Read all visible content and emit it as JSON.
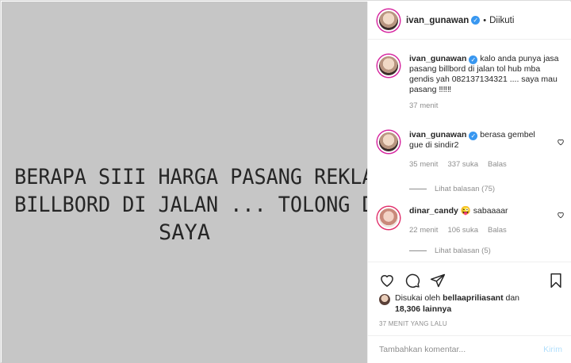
{
  "post": {
    "image_text": [
      "BERAPA SIII HARGA PASANG REKLAME",
      "BILLBORD DI JALAN ... TOLONG  DM  KE",
      "SAYA"
    ]
  },
  "header": {
    "username": "ivan_gunawan",
    "verified_icon": "✓",
    "separator": "•",
    "follow_status": "Diikuti"
  },
  "comments": [
    {
      "username": "ivan_gunawan",
      "text": "kalo anda punya jasa pasang billbord di jalan tol hub mba gendis yah 082137134321 .... saya mau pasang ‼‼‼",
      "time": "37 menit"
    },
    {
      "username": "ivan_gunawan",
      "text": "berasa gembel gue di sindir2",
      "time": "35 menit",
      "likes": "337 suka",
      "reply": "Balas",
      "view_replies": "Lihat balasan (75)"
    },
    {
      "username": "dinar_candy",
      "text": "😜 sabaaaar",
      "time": "22 menit",
      "likes": "106 suka",
      "reply": "Balas",
      "view_replies": "Lihat balasan (5)"
    }
  ],
  "likes": {
    "prefix": "Disukai oleh",
    "user": "bellaapriliasant",
    "conj": "dan",
    "others": "18,306 lainnya"
  },
  "timestamp": "37 MENIT YANG LALU",
  "comment_input": {
    "placeholder": "Tambahkan komentar...",
    "send_label": "Kirim"
  },
  "colors": {
    "accent": "#3897f0",
    "muted": "#8e8e8e",
    "image_bg": "#c6c6c6",
    "send_disabled": "#b2dffc"
  }
}
